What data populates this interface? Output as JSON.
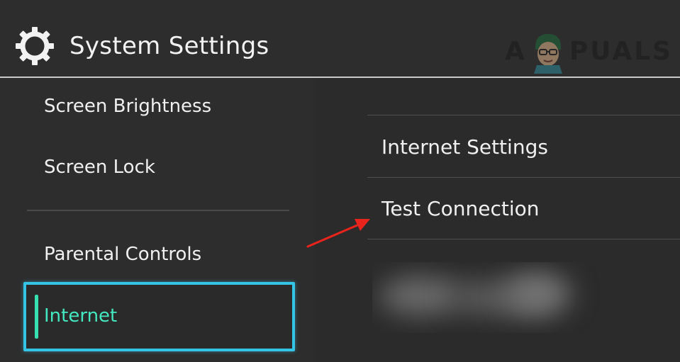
{
  "header": {
    "title": "System Settings",
    "icon": "gear-icon"
  },
  "watermark": {
    "left_text": "A",
    "right_text": "PUALS"
  },
  "left_menu": {
    "items": [
      {
        "label": "Screen Brightness"
      },
      {
        "label": "Screen Lock"
      },
      {
        "label": "Parental Controls"
      }
    ],
    "selected": {
      "label": "Internet"
    }
  },
  "right_menu": {
    "items": [
      {
        "label": "Internet Settings"
      },
      {
        "label": "Test Connection"
      }
    ]
  },
  "colors": {
    "background": "#2d2d2d",
    "text": "#f0f0f0",
    "selection_border": "#33c4e6",
    "selection_text": "#44e8c0",
    "annotation_arrow": "#e8241c"
  }
}
